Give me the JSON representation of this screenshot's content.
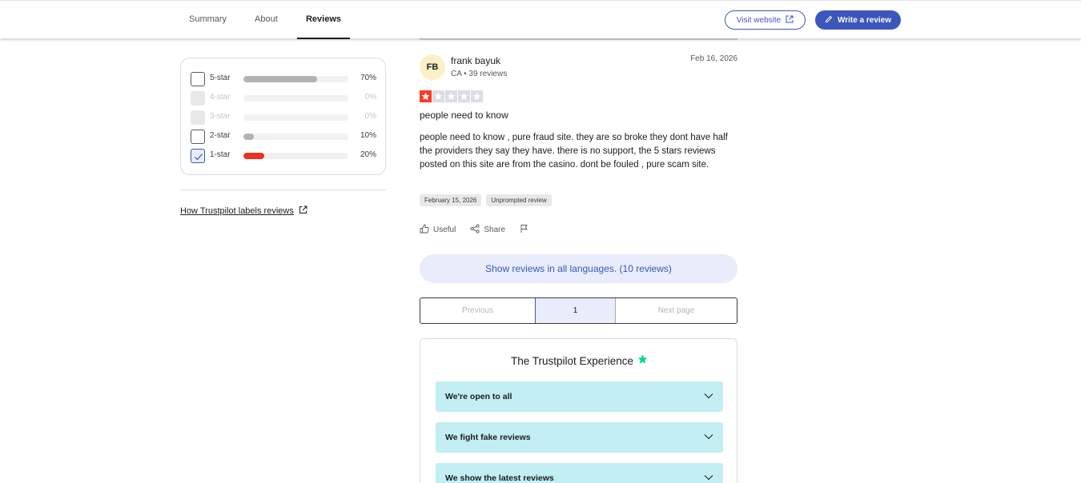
{
  "nav": {
    "tabs": [
      {
        "label": "Summary"
      },
      {
        "label": "About"
      },
      {
        "label": "Reviews"
      }
    ],
    "visit_label": "Visit website",
    "write_label": "Write a review"
  },
  "filter": {
    "rows": [
      {
        "label": "5-star",
        "percent_text": "70%",
        "percent": 70,
        "state": "unchecked"
      },
      {
        "label": "4-star",
        "percent_text": "0%",
        "percent": 0,
        "state": "disabled"
      },
      {
        "label": "3-star",
        "percent_text": "0%",
        "percent": 0,
        "state": "disabled"
      },
      {
        "label": "2-star",
        "percent_text": "10%",
        "percent": 10,
        "state": "unchecked"
      },
      {
        "label": "1-star",
        "percent_text": "20%",
        "percent": 20,
        "state": "checked"
      }
    ],
    "link_label": "How Trustpilot labels reviews"
  },
  "review": {
    "initials": "FB",
    "name": "frank bayuk",
    "meta": "CA • 39 reviews",
    "date": "Feb 16, 2026",
    "rating": 1,
    "title": "people need to know",
    "body": "people need to know , pure fraud site. they are so broke they dont have half the providers they say they have. there is no support, the 5 stars reviews posted on this site are from the casino. dont be fouled , pure scam site.",
    "chips": [
      "February 15, 2026",
      "Unprompted review"
    ],
    "useful_label": "Useful",
    "share_label": "Share"
  },
  "show_langs_label": "Show reviews in all languages. (10 reviews)",
  "pagination": {
    "prev_label": "Previous",
    "current": "1",
    "next_label": "Next page"
  },
  "experience": {
    "title": "The Trustpilot Experience",
    "items": [
      {
        "label": "We're open to all"
      },
      {
        "label": "We fight fake reviews"
      },
      {
        "label": "We show the latest reviews"
      }
    ]
  },
  "colors": {
    "brand": "#3c57bc",
    "bar_grey": "#b3b3b3",
    "bar_red": "#ea3323",
    "star_red": "#ff3722",
    "star_empty": "#dcdce6",
    "accordion": "#c3eef3",
    "trustpilot_green": "#04da8d"
  }
}
